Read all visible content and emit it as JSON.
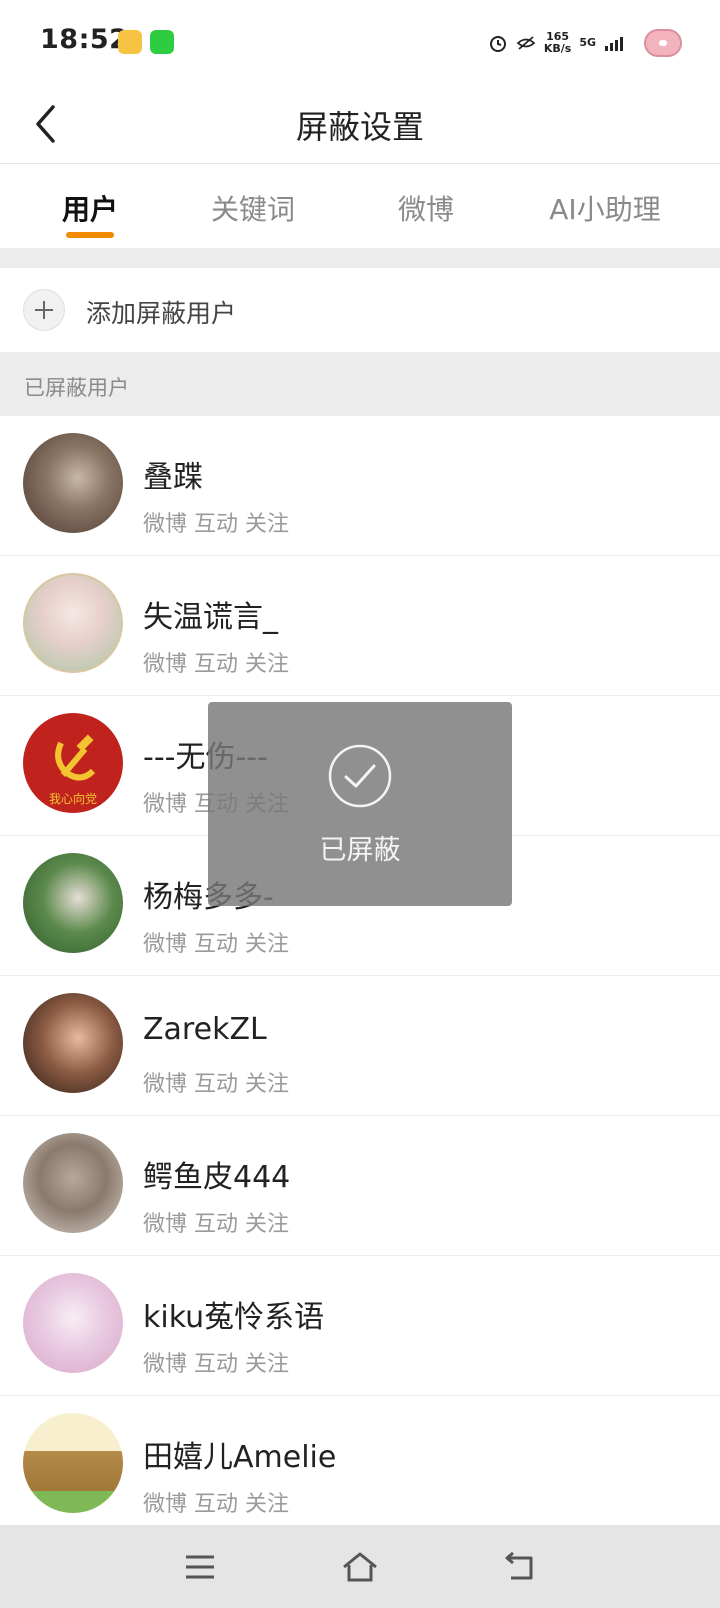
{
  "status_bar": {
    "time": "18:52",
    "net_speed_value": "165",
    "net_speed_unit": "KB/s",
    "network": "5G",
    "icons": [
      "weibo-app-icon",
      "wechat-icon",
      "alarm-icon",
      "eye-off-icon",
      "signal-icon",
      "donut-icon"
    ]
  },
  "header": {
    "title": "屏蔽设置"
  },
  "tabs": [
    {
      "label": "用户",
      "active": true
    },
    {
      "label": "关键词",
      "active": false
    },
    {
      "label": "微博",
      "active": false
    },
    {
      "label": "AI小助理",
      "active": false
    }
  ],
  "add_user": {
    "label": "添加屏蔽用户"
  },
  "section": {
    "label": "已屏蔽用户"
  },
  "users": [
    {
      "name": "叠蹀",
      "meta": "微博 互动 关注"
    },
    {
      "name": "失温谎言_",
      "meta": "微博 互动 关注"
    },
    {
      "name": "---无伤---",
      "meta": "微博 互动 关注",
      "avatar_text": "我心向党"
    },
    {
      "name": "杨梅多多-",
      "meta": "微博 互动 关注"
    },
    {
      "name": "ZarekZL",
      "meta": "微博 互动 关注"
    },
    {
      "name": "鳄鱼皮444",
      "meta": "微博 互动 关注"
    },
    {
      "name": "kiku菟怜系语",
      "meta": "微博 互动 关注"
    },
    {
      "name": "田嬉儿Amelie",
      "meta": "微博 互动 关注"
    }
  ],
  "toast": {
    "text": "已屏蔽"
  },
  "colors": {
    "accent": "#f08a00",
    "section_bg": "#ececec",
    "meta_text": "#9a9a9a",
    "toast_bg": "#7a7a7a"
  }
}
